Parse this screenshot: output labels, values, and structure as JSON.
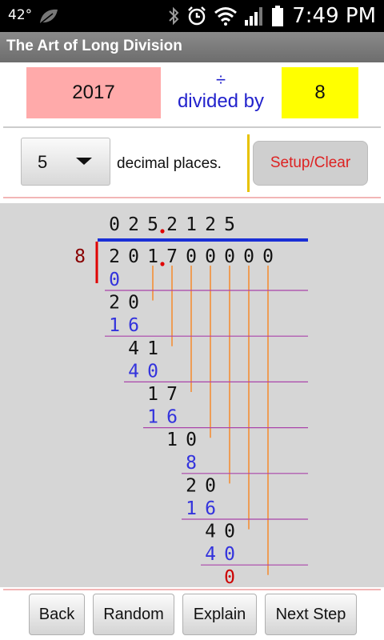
{
  "status": {
    "temp": "42°",
    "time": "7:49 PM"
  },
  "app": {
    "title": "The Art of Long Division"
  },
  "inputs": {
    "dividend": "2017",
    "divide_symbol": "÷",
    "divide_text": "divided by",
    "divisor": "8"
  },
  "decimals": {
    "selected": "5",
    "label": "decimal places."
  },
  "setup_label": "Setup/Clear",
  "division": {
    "divisor": "8",
    "quotient": [
      "0",
      "2",
      "5",
      "2",
      "1",
      "2",
      "5"
    ],
    "quotient_decimal_after": 3,
    "dividend": [
      "2",
      "0",
      "1",
      "7",
      "0",
      "0",
      "0",
      "0",
      "0"
    ],
    "dividend_decimal_after": 3,
    "steps": [
      {
        "sub": "0",
        "col": 0
      },
      {
        "rem": "20",
        "col": 1
      },
      {
        "sub": "16",
        "col": 1
      },
      {
        "rem": "41",
        "col": 2
      },
      {
        "sub": "40",
        "col": 2
      },
      {
        "rem": "17",
        "col": 3
      },
      {
        "sub": "16",
        "col": 3
      },
      {
        "rem": "10",
        "col": 4
      },
      {
        "sub": "8",
        "col": 4
      },
      {
        "rem": "20",
        "col": 5
      },
      {
        "sub": "16",
        "col": 5
      },
      {
        "rem": "40",
        "col": 6
      },
      {
        "sub": "40",
        "col": 6
      },
      {
        "final": "0",
        "col": 6
      }
    ],
    "colors": {
      "quotient": "#111111",
      "dividend": "#111111",
      "subtract": "#3333dd",
      "remainder": "#111111",
      "final": "#cc0000",
      "divisor": "#880000",
      "bar": "#1a2fd6",
      "bracket": "#e00000",
      "line": "#aa44aa",
      "guide": "#ff7700",
      "dot": "#e00000"
    }
  },
  "buttons": {
    "back": "Back",
    "random": "Random",
    "explain": "Explain",
    "next": "Next Step"
  }
}
